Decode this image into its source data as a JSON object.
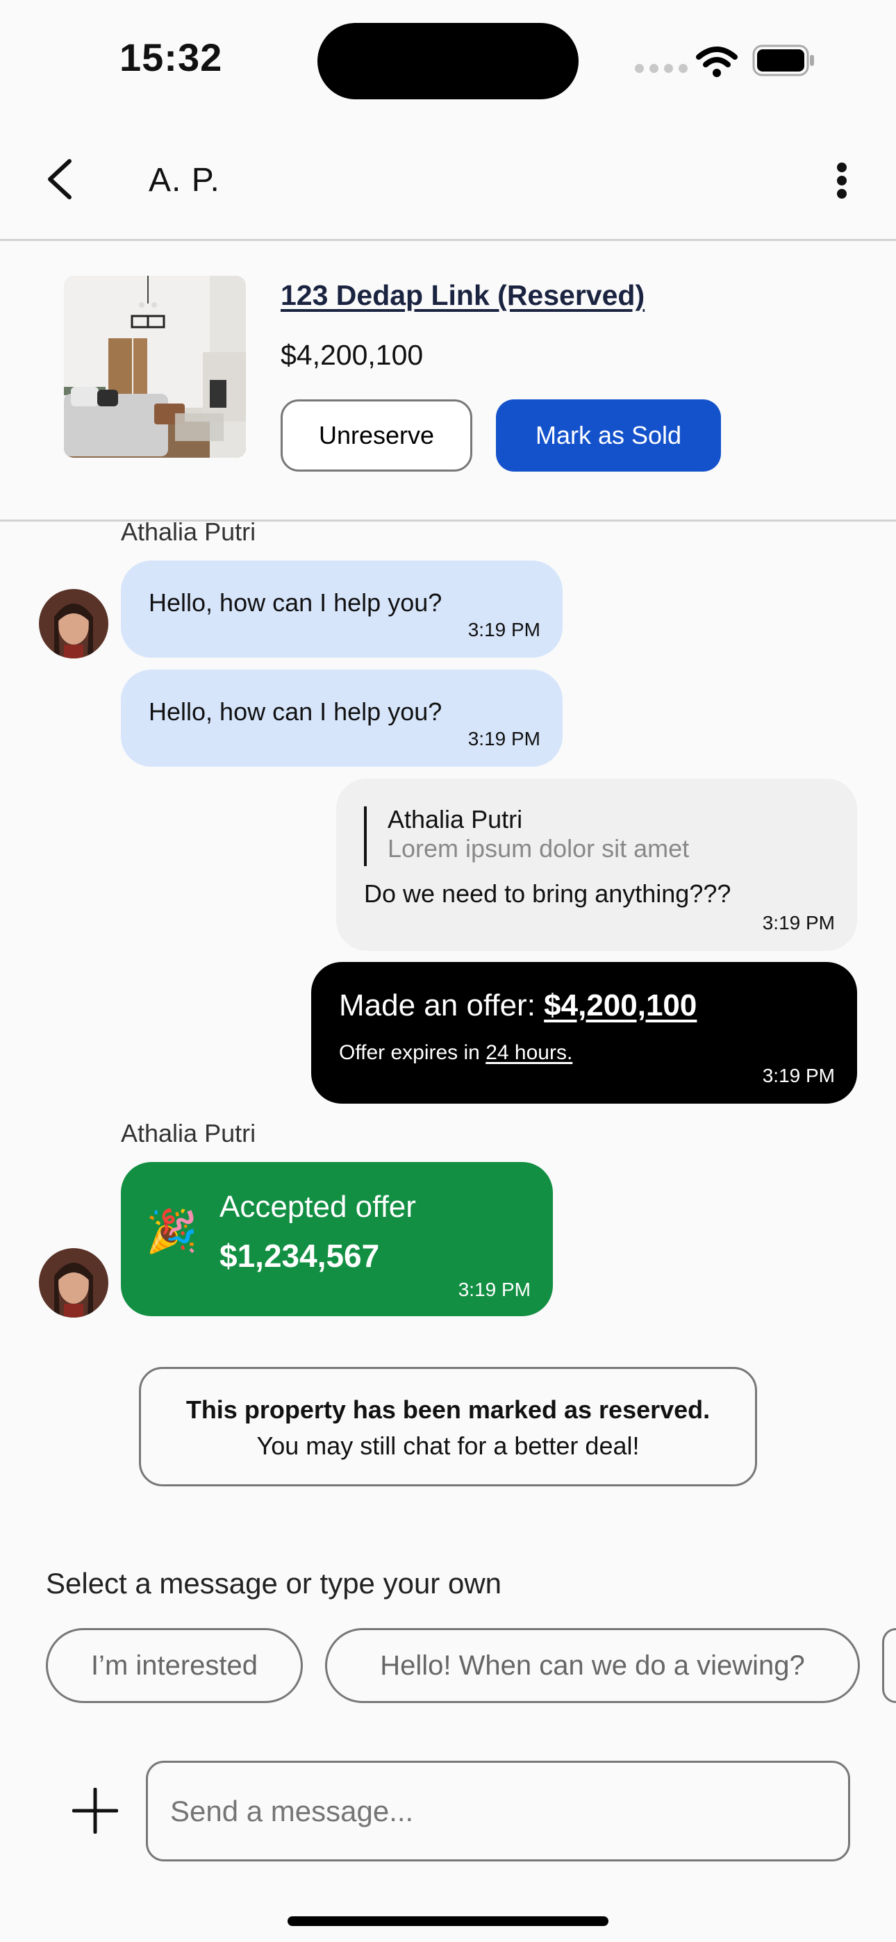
{
  "status_bar": {
    "time": "15:32"
  },
  "header": {
    "title": "A. P."
  },
  "listing": {
    "title": "123 Dedap Link (Reserved)",
    "price": "$4,200,100",
    "unreserve_label": "Unreserve",
    "mark_sold_label": "Mark as Sold"
  },
  "messages": {
    "sender_1": "Athalia Putri",
    "msg_1": {
      "text": "Hello, how can I help you?",
      "time": "3:19 PM"
    },
    "msg_2": {
      "text": "Hello, how can I help you?",
      "time": "3:19 PM"
    },
    "reply": {
      "quote_author": "Athalia Putri",
      "quote_text": "Lorem ipsum dolor sit amet",
      "text": "Do we need to bring anything???",
      "time": "3:19 PM"
    },
    "offer": {
      "prefix": "Made an offer: ",
      "amount": "$4,200,100",
      "expires_prefix": "Offer expires in ",
      "expires_value": "24 hours.",
      "time": "3:19 PM"
    },
    "sender_2": "Athalia Putri",
    "accepted": {
      "emoji": "🎉",
      "title": "Accepted offer",
      "amount": "$1,234,567",
      "time": "3:19 PM"
    }
  },
  "notice": {
    "line1": "This property has been marked as reserved.",
    "line2": "You may still chat for a better deal!"
  },
  "suggestions": {
    "label": "Select a message or type your own",
    "items": [
      "I’m interested",
      "Hello! When can we do a viewing?"
    ]
  },
  "composer": {
    "placeholder": "Send a message..."
  },
  "colors": {
    "primary": "#1452cc",
    "incoming_bubble": "#d7e5fb",
    "accepted": "#138f43",
    "offer": "#000000"
  }
}
